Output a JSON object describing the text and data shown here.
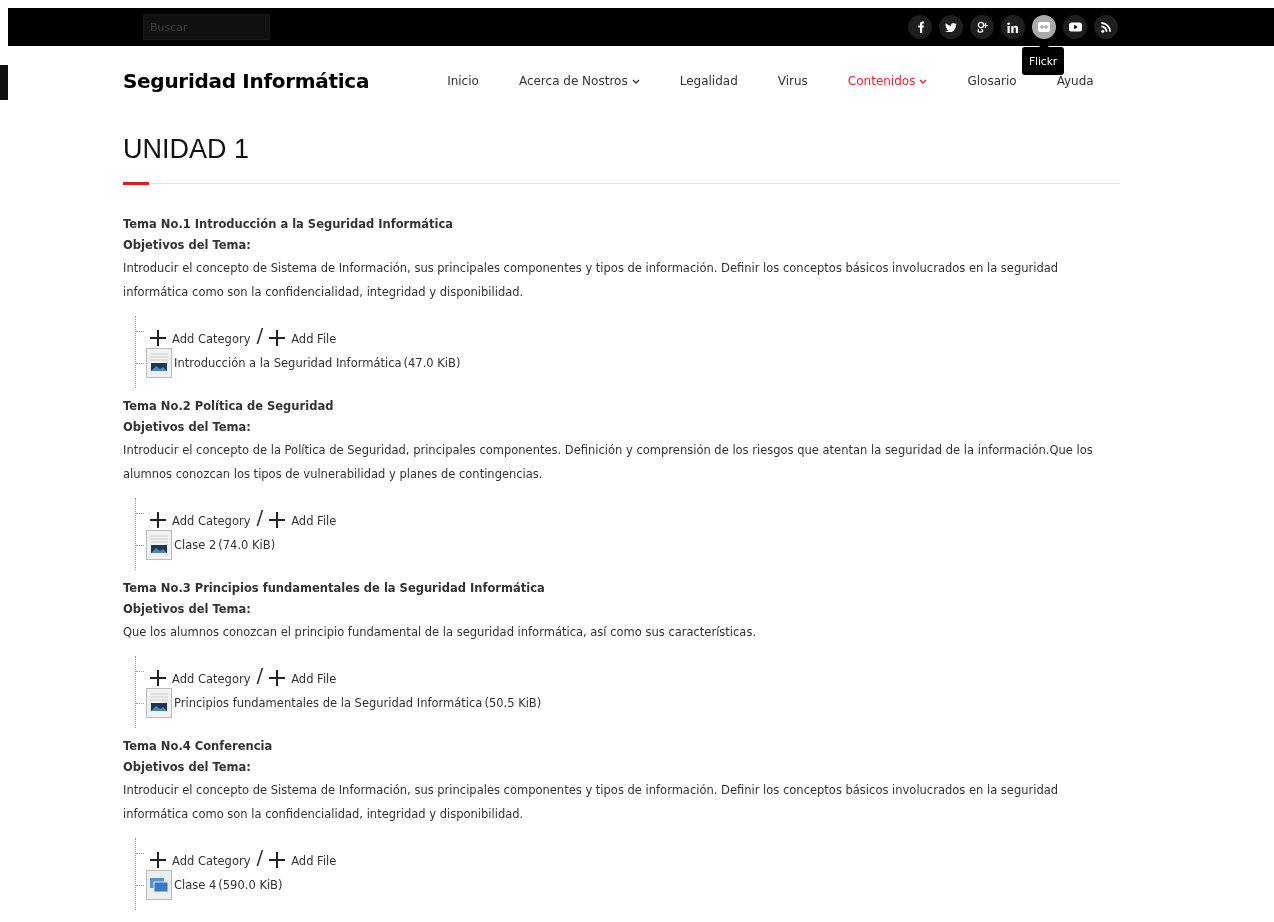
{
  "top_bar": {
    "search": {
      "placeholder": "Buscar"
    },
    "social": [
      {
        "kind": "facebook",
        "hovered": false
      },
      {
        "kind": "twitter",
        "hovered": false
      },
      {
        "kind": "googleplus",
        "hovered": false
      },
      {
        "kind": "linkedin",
        "hovered": false
      },
      {
        "kind": "flickr",
        "hovered": true
      },
      {
        "kind": "youtube",
        "hovered": false
      },
      {
        "kind": "rss",
        "hovered": false
      }
    ],
    "tooltip": "Flickr"
  },
  "header": {
    "site_title": "Seguridad Informática",
    "menu": [
      {
        "label": "Inicio",
        "selected": false,
        "dropdown": false
      },
      {
        "label": "Acerca de Nostros",
        "selected": false,
        "dropdown": true
      },
      {
        "label": "Legalidad",
        "selected": false,
        "dropdown": false
      },
      {
        "label": "Virus",
        "selected": false,
        "dropdown": false
      },
      {
        "label": "Contenidos",
        "selected": true,
        "dropdown": true
      },
      {
        "label": "Glosario",
        "selected": false,
        "dropdown": false
      },
      {
        "label": "Ayuda",
        "selected": false,
        "dropdown": false
      }
    ]
  },
  "page_title": "UNIDAD 1",
  "sections": [
    {
      "title": "Tema No.1 Introducción a la Seguridad Informática",
      "objectives_label": "Objetivos del Tema:",
      "description": "Introducir el concepto de Sistema de Información, sus principales componentes y tipos de información. Definir los conceptos básicos involucrados en la  seguridad informática como son la confidencialidad, integridad y disponibilidad.",
      "add_category": "Add Category",
      "separator": "/",
      "add_file": "Add File",
      "files": [
        {
          "kind": "document",
          "name": "Introducción a la Seguridad Informática",
          "size": "(47.0 KiB)"
        }
      ]
    },
    {
      "title": "Tema No.2 Política de Seguridad",
      "objectives_label": "Objetivos del Tema:",
      "description": "Introducir el concepto de la Política de Seguridad, principales componentes. Definición y comprensión de los riesgos que atentan la seguridad de la información.Que los alumnos conozcan los tipos de vulnerabilidad y planes de contingencias.",
      "add_category": "Add Category",
      "separator": "/",
      "add_file": "Add File",
      "files": [
        {
          "kind": "document",
          "name": "Clase 2",
          "size": "(74.0 KiB)"
        }
      ]
    },
    {
      "title": "Tema No.3 Principios fundamentales de la Seguridad Informática",
      "objectives_label": "Objetivos del Tema:",
      "description": "Que los alumnos conozcan el principio fundamental de la seguridad informática, así como sus características.",
      "add_category": "Add Category",
      "separator": "/",
      "add_file": "Add File",
      "files": [
        {
          "kind": "document",
          "name": "Principios fundamentales de la Seguridad Informática",
          "size": "(50.5 KiB)"
        }
      ]
    },
    {
      "title": "Tema No.4 Conferencia",
      "objectives_label": "Objetivos del Tema:",
      "description": "Introducir el concepto de Sistema de Información, sus principales componentes y tipos de información. Definir los conceptos básicos involucrados en la seguridad informática como son la confidencialidad, integridad y disponibilidad.",
      "add_category": "Add Category",
      "separator": "/",
      "add_file": "Add File",
      "files": [
        {
          "kind": "slides",
          "name": "Clase 4",
          "size": "(590.0 KiB)"
        }
      ]
    }
  ]
}
